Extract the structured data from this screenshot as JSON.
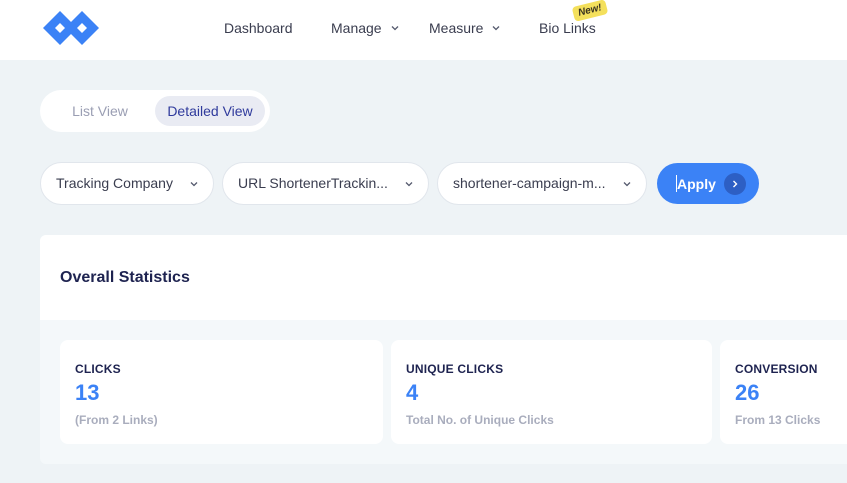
{
  "nav": {
    "dashboard": "Dashboard",
    "manage": "Manage",
    "measure": "Measure",
    "bio_links": "Bio Links",
    "new_badge": "New!"
  },
  "view_toggle": {
    "list": "List View",
    "detailed": "Detailed View",
    "active": "Detailed View"
  },
  "filters": {
    "company": "Tracking Company",
    "url": "URL ShortenerTrackin...",
    "campaign": "shortener-campaign-m..."
  },
  "apply_label": "Apply",
  "stats": {
    "title": "Overall Statistics",
    "cards": [
      {
        "label": "CLICKS",
        "value": "13",
        "sub": "(From 2 Links)"
      },
      {
        "label": "UNIQUE CLICKS",
        "value": "4",
        "sub": "Total No. of Unique Clicks"
      },
      {
        "label": "CONVERSION",
        "value": "26",
        "sub": "From 13 Clicks"
      }
    ]
  },
  "colors": {
    "accent": "#3b82f6",
    "background": "#eef3f6",
    "badge": "#f4e05c"
  },
  "icons": [
    "logo-icon",
    "chevron-down-icon",
    "chevron-right-icon"
  ]
}
